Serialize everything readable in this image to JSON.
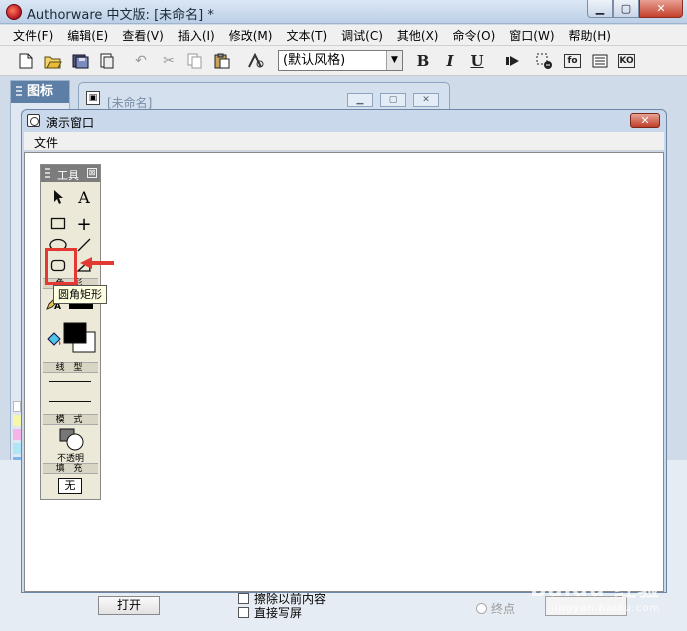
{
  "app": {
    "title": "Authorware 中文版: [未命名] *",
    "window_buttons": [
      "▁",
      "▢",
      "✕"
    ]
  },
  "menubar": [
    "文件(F)",
    "编辑(E)",
    "查看(V)",
    "插入(I)",
    "修改(M)",
    "文本(T)",
    "调试(C)",
    "其他(X)",
    "命令(O)",
    "窗口(W)",
    "帮助(H)"
  ],
  "toolbar": {
    "style_select": "(默认风格)",
    "bold": "B",
    "italic": "I",
    "underline": "U",
    "fn_box": "fo",
    "ko_box": "KO"
  },
  "icons_panel": {
    "title": "图标",
    "swatch_colors": [
      "#ffffff",
      "#f5f7a8",
      "#f6b3e8",
      "#aee6f7",
      "#7eb4e8"
    ]
  },
  "design_window": {
    "title": "[未命名]"
  },
  "presentation": {
    "title": "演示窗口",
    "menu": "文件",
    "close": "✕"
  },
  "tools": {
    "title": "工具",
    "close": "⊠",
    "sections": {
      "color": "色 彩",
      "line": "线 型",
      "mode": "模 式",
      "fill": "填 充"
    },
    "mode_label": "不透明",
    "fill_value": "无",
    "tooltip": "圆角矩形",
    "highlight_color": "#e23a32"
  },
  "bottom": {
    "open_button": "打开",
    "checkbox1": "擦除以前内容",
    "checkbox2": "直接写屏",
    "radio": "终点"
  },
  "watermark": {
    "main": "Baidu 经验",
    "sub": "jingyan.baidu.com"
  }
}
